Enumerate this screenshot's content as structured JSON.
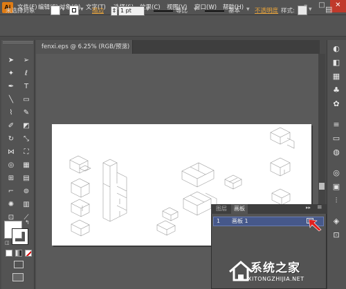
{
  "app": {
    "logo": "Ai"
  },
  "menu": [
    "文件(F)",
    "编辑(E)",
    "对象(O)",
    "文字(T)",
    "选择(S)",
    "效果(C)",
    "视图(V)",
    "窗口(W)",
    "帮助(H)"
  ],
  "window_controls": {
    "minimize": "–",
    "maximize": "□",
    "close": "✕"
  },
  "control_bar": {
    "selection_status": "未选择对象",
    "stroke_label": "描边",
    "stroke_weight": "1 pt",
    "profile_label": "等比",
    "brush_label": "基本",
    "opacity_label": "不透明度",
    "style_label": "样式:"
  },
  "document_tab": {
    "title": "fenxi.eps @ 6.25% (RGB/预览)",
    "close": "×"
  },
  "artboards_panel": {
    "tabs": [
      "图层",
      "画板"
    ],
    "rows": [
      {
        "number": "1",
        "name": "画板 1"
      }
    ]
  },
  "watermark": {
    "title": "系统之家",
    "url": "XITONGZHIJIA.NET"
  },
  "colors": {
    "accent_arrow": "#e02020",
    "selected_row": "#46588a",
    "logo": "#e07c14"
  },
  "toolbox": {
    "tools": [
      "selection-icon",
      "direct-selection-icon",
      "magic-wand-icon",
      "lasso-icon",
      "pen-icon",
      "type-icon",
      "line-icon",
      "rectangle-icon",
      "paintbrush-icon",
      "pencil-icon",
      "blob-brush-icon",
      "eraser-icon",
      "rotate-icon",
      "scale-icon",
      "width-icon",
      "free-transform-icon",
      "shape-builder-icon",
      "perspective-icon",
      "mesh-icon",
      "gradient-icon",
      "eyedropper-icon",
      "blend-icon",
      "symbol-sprayer-icon",
      "graph-icon",
      "artboard-icon",
      "slice-icon",
      "hand-icon",
      "zoom-icon"
    ]
  }
}
